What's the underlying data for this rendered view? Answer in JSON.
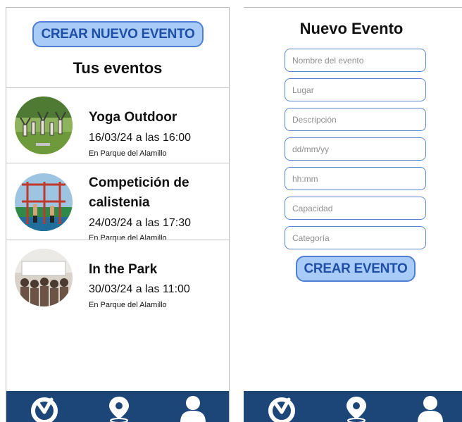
{
  "left_screen": {
    "create_button_label": "CREAR NUEVO EVENTO",
    "section_title": "Tus eventos",
    "events": [
      {
        "title_lines": [
          "Yoga Outdoor"
        ],
        "date": "16/03/24 a las 16:00",
        "place": "En Parque del Alamillo",
        "image": "yoga-group-photo"
      },
      {
        "title_lines": [
          "Competición de",
          "calistenia"
        ],
        "date": "24/03/24 a las 17:30",
        "place": "En Parque del Alamillo",
        "image": "calisthenics-bars-photo"
      },
      {
        "title_lines": [
          "In the Park"
        ],
        "date": "30/03/24 a las 11:00",
        "place": "En Parque del Alamillo",
        "image": "park-concert-photo"
      }
    ]
  },
  "right_screen": {
    "title": "Nuevo Evento",
    "fields": [
      {
        "placeholder": "Nombre del evento",
        "value": ""
      },
      {
        "placeholder": "Lugar",
        "value": ""
      },
      {
        "placeholder": "Descripción",
        "value": ""
      },
      {
        "placeholder": "dd/mm/yy",
        "value": ""
      },
      {
        "placeholder": "hh:mm",
        "value": ""
      },
      {
        "placeholder": "Capacidad",
        "value": ""
      },
      {
        "placeholder": "Categoría",
        "value": ""
      }
    ],
    "submit_label": "CREAR EVENTO"
  },
  "tabbar": {
    "items": [
      {
        "icon": "clock-icon"
      },
      {
        "icon": "map-pin-icon"
      },
      {
        "icon": "user-icon"
      }
    ]
  },
  "colors": {
    "button_fill": "#a9cbf7",
    "button_border": "#4f7fd1",
    "button_text": "#1f4fa5",
    "field_border": "#5b86cf",
    "tabbar": "#1c4678"
  }
}
